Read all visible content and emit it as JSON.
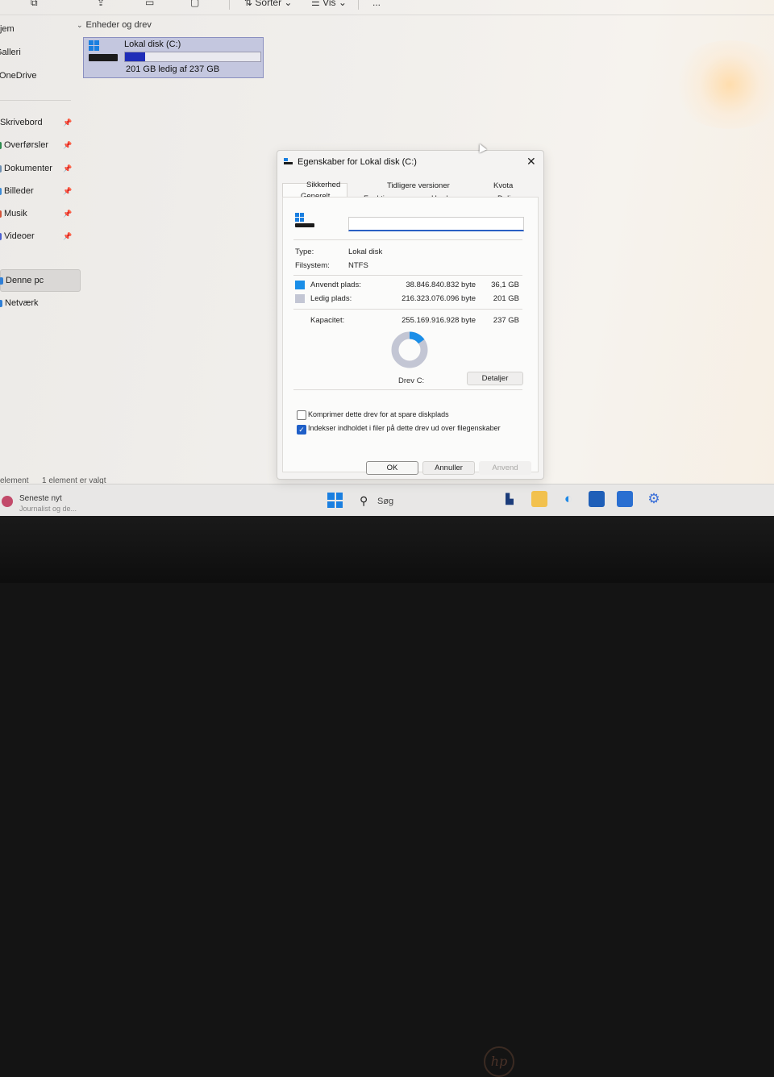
{
  "toolbar": {
    "sort_label": "Sortér",
    "view_label": "Vis",
    "more_label": "..."
  },
  "sidebar": {
    "items": [
      {
        "label": "Hjem"
      },
      {
        "label": "Galleri"
      },
      {
        "label": "OneDrive"
      },
      {
        "label": "Skrivebord"
      },
      {
        "label": "Overførsler"
      },
      {
        "label": "Dokumenter"
      },
      {
        "label": "Billeder"
      },
      {
        "label": "Musik"
      },
      {
        "label": "Videoer"
      },
      {
        "label": "Denne pc"
      },
      {
        "label": "Netværk"
      }
    ]
  },
  "main": {
    "section_title": "Enheder og drev",
    "drive": {
      "name": "Lokal disk (C:)",
      "free_text": "201 GB ledig af 237 GB",
      "used_fraction": 0.15
    }
  },
  "status_bar": {
    "count": "element",
    "selected": "1 element er valgt"
  },
  "dialog": {
    "title": "Egenskaber for Lokal disk (C:)",
    "tabs_top": [
      "Sikkerhed",
      "Tidligere versioner",
      "Kvota"
    ],
    "tabs_bottom": [
      "Generelt",
      "Funktioner",
      "Hardware",
      "Deling"
    ],
    "name_value": "",
    "type_label": "Type:",
    "type_value": "Lokal disk",
    "fs_label": "Filsystem:",
    "fs_value": "NTFS",
    "used": {
      "label": "Anvendt plads:",
      "bytes": "38.846.840.832 byte",
      "gb": "36,1 GB",
      "color": "#1a8ee8"
    },
    "free": {
      "label": "Ledig plads:",
      "bytes": "216.323.076.096 byte",
      "gb": "201 GB",
      "color": "#c3c6d4"
    },
    "capacity": {
      "label": "Kapacitet:",
      "bytes": "255.169.916.928 byte",
      "gb": "237 GB"
    },
    "used_fraction": 0.152,
    "drive_label": "Drev C:",
    "details_button": "Detaljer",
    "compress_label": "Komprimer dette drev for at spare diskplads",
    "compress_checked": false,
    "index_label": "Indekser indholdet i filer på dette drev ud over filegenskaber",
    "index_checked": true,
    "ok_label": "OK",
    "cancel_label": "Annuller",
    "apply_label": "Anvend"
  },
  "taskbar": {
    "news_title": "Seneste nyt",
    "news_sub": "Journalist og de...",
    "search_label": "Søg"
  },
  "bezel": {
    "logo_text": "hp"
  }
}
